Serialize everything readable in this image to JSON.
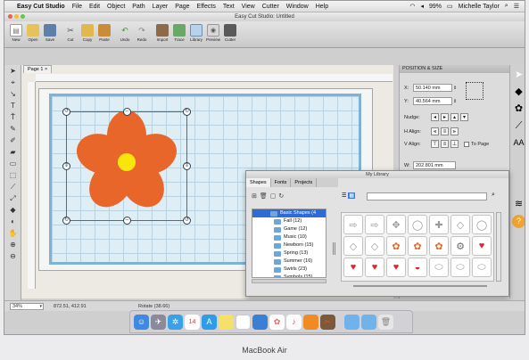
{
  "menubar": {
    "app_name": "Easy Cut Studio",
    "items": [
      "File",
      "Edit",
      "Object",
      "Path",
      "Layer",
      "Page",
      "Effects",
      "Text",
      "View",
      "Cutter",
      "Window",
      "Help"
    ],
    "battery": "99%",
    "user": "Michelle Taylor"
  },
  "window": {
    "title": "Easy Cut Studio: Untitled"
  },
  "toolbar": {
    "buttons": [
      {
        "label": "New",
        "icon": "new-doc-icon"
      },
      {
        "label": "Open",
        "icon": "folder-open-icon"
      },
      {
        "label": "Save",
        "icon": "save-icon"
      },
      {
        "label": "Cut",
        "icon": "scissors-icon"
      },
      {
        "label": "Copy",
        "icon": "copy-icon"
      },
      {
        "label": "Paste",
        "icon": "paste-icon"
      },
      {
        "label": "Undo",
        "icon": "undo-icon"
      },
      {
        "label": "Redo",
        "icon": "redo-icon"
      },
      {
        "label": "Import",
        "icon": "import-icon"
      },
      {
        "label": "Trace",
        "icon": "trace-icon"
      },
      {
        "label": "Library",
        "icon": "library-icon"
      },
      {
        "label": "Preview",
        "icon": "preview-icon"
      },
      {
        "label": "Cutter",
        "icon": "cutter-icon"
      }
    ]
  },
  "document": {
    "tab_label": "Page 1"
  },
  "position_panel": {
    "title": "POSITION & SIZE",
    "x_label": "X:",
    "x_value": "50.140 mm",
    "y_label": "Y:",
    "y_value": "40.564 mm",
    "nudge_label": "Nudge:",
    "h_align_label": "H Align:",
    "v_align_label": "V Align:",
    "to_page_label": "To Page",
    "w_label": "W:",
    "w_value": "202.801 mm"
  },
  "library": {
    "title": "My Library",
    "tabs": [
      "Shapes",
      "Fonts",
      "Projects"
    ],
    "tree": [
      {
        "label": "Basic Shapes (4",
        "selected": true
      },
      {
        "label": "Fall (12)",
        "selected": false
      },
      {
        "label": "Game (12)",
        "selected": false
      },
      {
        "label": "Music (10)",
        "selected": false
      },
      {
        "label": "Newborn (15)",
        "selected": false
      },
      {
        "label": "Spring (13)",
        "selected": false
      },
      {
        "label": "Summer (16)",
        "selected": false
      },
      {
        "label": "Swirls (23)",
        "selected": false
      },
      {
        "label": "Symbols (15)",
        "selected": false
      }
    ],
    "shapes": [
      {
        "icon": "arrow-outline-icon",
        "color": "#ffffff"
      },
      {
        "icon": "arrow-outline-icon",
        "color": "#ffffff"
      },
      {
        "icon": "puzzle-outline-icon",
        "color": "#ffffff"
      },
      {
        "icon": "circle-outline-icon",
        "color": "#ffffff"
      },
      {
        "icon": "cross-outline-icon",
        "color": "#ffffff"
      },
      {
        "icon": "diamond-outline-icon",
        "color": "#ffffff"
      },
      {
        "icon": "circle-outline-icon",
        "color": "#ffffff"
      },
      {
        "icon": "diamond-outline-icon",
        "color": "#ffffff"
      },
      {
        "icon": "diamond-outline-icon",
        "color": "#ffffff"
      },
      {
        "icon": "flower-icon",
        "color": "#e8662a"
      },
      {
        "icon": "flower-icon",
        "color": "#e8662a"
      },
      {
        "icon": "flower-icon",
        "color": "#e8662a"
      },
      {
        "icon": "gear-icon",
        "color": "#6b6b6b"
      },
      {
        "icon": "heart-icon",
        "color": "#e02727"
      },
      {
        "icon": "heart-icon",
        "color": "#e02727"
      },
      {
        "icon": "heart-icon",
        "color": "#e02727"
      },
      {
        "icon": "heart-icon",
        "color": "#e02727"
      },
      {
        "icon": "lips-icon",
        "color": "#d82020"
      },
      {
        "icon": "oval-outline-icon",
        "color": "#ffffff"
      },
      {
        "icon": "oval-outline-icon",
        "color": "#ffffff"
      },
      {
        "icon": "oval-outline-icon",
        "color": "#ffffff"
      }
    ]
  },
  "status": {
    "zoom": "34%",
    "coords": "872.51, 412.91",
    "mode": "Rotate (38.66)"
  },
  "flower": {
    "petal_color": "#e8662a",
    "center_color": "#f7e60c"
  },
  "laptop_label": "MacBook Air"
}
